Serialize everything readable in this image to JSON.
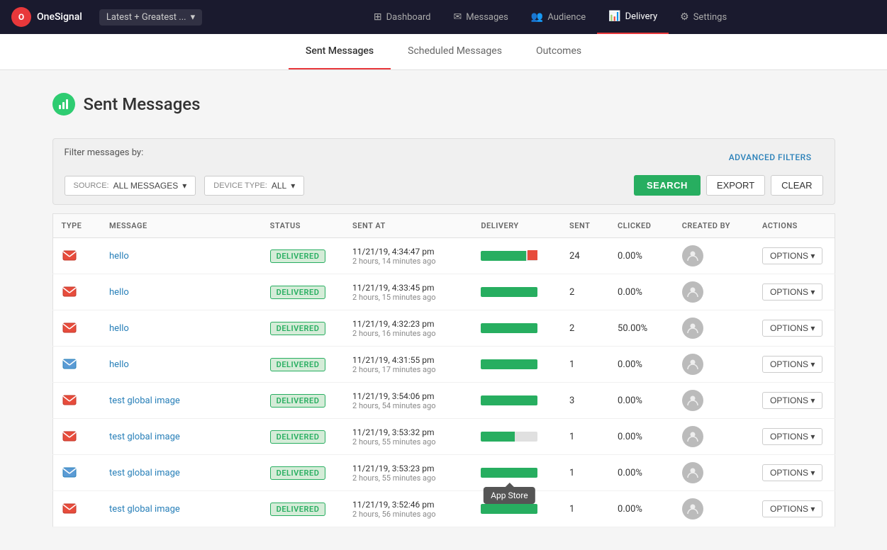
{
  "brand": {
    "logo_text": "O",
    "name": "OneSignal",
    "app_selector_label": "Latest + Greatest ...",
    "dropdown_icon": "▾"
  },
  "nav": {
    "links": [
      {
        "id": "dashboard",
        "label": "Dashboard",
        "icon": "⊞",
        "active": false
      },
      {
        "id": "messages",
        "label": "Messages",
        "icon": "✉",
        "active": false
      },
      {
        "id": "audience",
        "label": "Audience",
        "icon": "👥",
        "active": false
      },
      {
        "id": "delivery",
        "label": "Delivery",
        "icon": "📊",
        "active": true
      },
      {
        "id": "settings",
        "label": "Settings",
        "icon": "⚙",
        "active": false
      }
    ]
  },
  "tabs": [
    {
      "id": "sent",
      "label": "Sent Messages",
      "active": true
    },
    {
      "id": "scheduled",
      "label": "Scheduled Messages",
      "active": false
    },
    {
      "id": "outcomes",
      "label": "Outcomes",
      "active": false
    }
  ],
  "page": {
    "title": "Sent Messages",
    "icon": "📊"
  },
  "filter": {
    "label": "Filter messages by:",
    "source_label": "SOURCE:",
    "source_value": "ALL MESSAGES",
    "device_label": "DEVICE TYPE:",
    "device_value": "ALL",
    "advanced_filters": "ADVANCED FILTERS",
    "search_btn": "SEARCH",
    "export_btn": "EXPORT",
    "clear_btn": "CLEAR"
  },
  "table": {
    "columns": [
      "TYPE",
      "MESSAGE",
      "STATUS",
      "SENT AT",
      "DELIVERY",
      "SENT",
      "CLICKED",
      "CREATED BY",
      "ACTIONS"
    ],
    "rows": [
      {
        "type": "push",
        "has_image": true,
        "message": "hello",
        "status": "DELIVERED",
        "sent_at": "11/21/19, 4:34:47 pm",
        "sent_at_relative": "2 hours, 14 minutes ago",
        "delivery_pct": 92,
        "has_red": true,
        "sent": "24",
        "clicked": "0.00%",
        "actions_label": "OPTIONS ▾"
      },
      {
        "type": "push",
        "has_image": true,
        "message": "hello",
        "status": "DELIVERED",
        "sent_at": "11/21/19, 4:33:45 pm",
        "sent_at_relative": "2 hours, 15 minutes ago",
        "delivery_pct": 100,
        "has_red": false,
        "sent": "2",
        "clicked": "0.00%",
        "actions_label": "OPTIONS ▾"
      },
      {
        "type": "push",
        "has_image": true,
        "message": "hello",
        "status": "DELIVERED",
        "sent_at": "11/21/19, 4:32:23 pm",
        "sent_at_relative": "2 hours, 16 minutes ago",
        "delivery_pct": 100,
        "has_red": false,
        "sent": "2",
        "clicked": "50.00%",
        "actions_label": "OPTIONS ▾"
      },
      {
        "type": "push",
        "has_image": false,
        "message": "hello",
        "status": "DELIVERED",
        "sent_at": "11/21/19, 4:31:55 pm",
        "sent_at_relative": "2 hours, 17 minutes ago",
        "delivery_pct": 100,
        "has_red": false,
        "sent": "1",
        "clicked": "0.00%",
        "actions_label": "OPTIONS ▾"
      },
      {
        "type": "push",
        "has_image": true,
        "message": "test global image",
        "status": "DELIVERED",
        "sent_at": "11/21/19, 3:54:06 pm",
        "sent_at_relative": "2 hours, 54 minutes ago",
        "delivery_pct": 100,
        "has_red": false,
        "sent": "3",
        "clicked": "0.00%",
        "actions_label": "OPTIONS ▾"
      },
      {
        "type": "push",
        "has_image": true,
        "message": "test global image",
        "status": "DELIVERED",
        "sent_at": "11/21/19, 3:53:32 pm",
        "sent_at_relative": "2 hours, 55 minutes ago",
        "delivery_pct": 60,
        "has_red": false,
        "sent": "1",
        "clicked": "0.00%",
        "actions_label": "OPTIONS ▾"
      },
      {
        "type": "push",
        "has_image": false,
        "message": "test global image",
        "status": "DELIVERED",
        "sent_at": "11/21/19, 3:53:23 pm",
        "sent_at_relative": "2 hours, 55 minutes ago",
        "delivery_pct": 100,
        "has_red": false,
        "sent": "1",
        "clicked": "0.00%",
        "actions_label": "OPTIONS ▾",
        "show_tooltip": true,
        "tooltip_text": "App Store"
      },
      {
        "type": "push",
        "has_image": true,
        "message": "test global image",
        "status": "DELIVERED",
        "sent_at": "11/21/19, 3:52:46 pm",
        "sent_at_relative": "2 hours, 56 minutes ago",
        "delivery_pct": 100,
        "has_red": false,
        "sent": "1",
        "clicked": "0.00%",
        "actions_label": "OPTIONS ▾"
      }
    ]
  },
  "tooltip": {
    "text": "App Store"
  }
}
